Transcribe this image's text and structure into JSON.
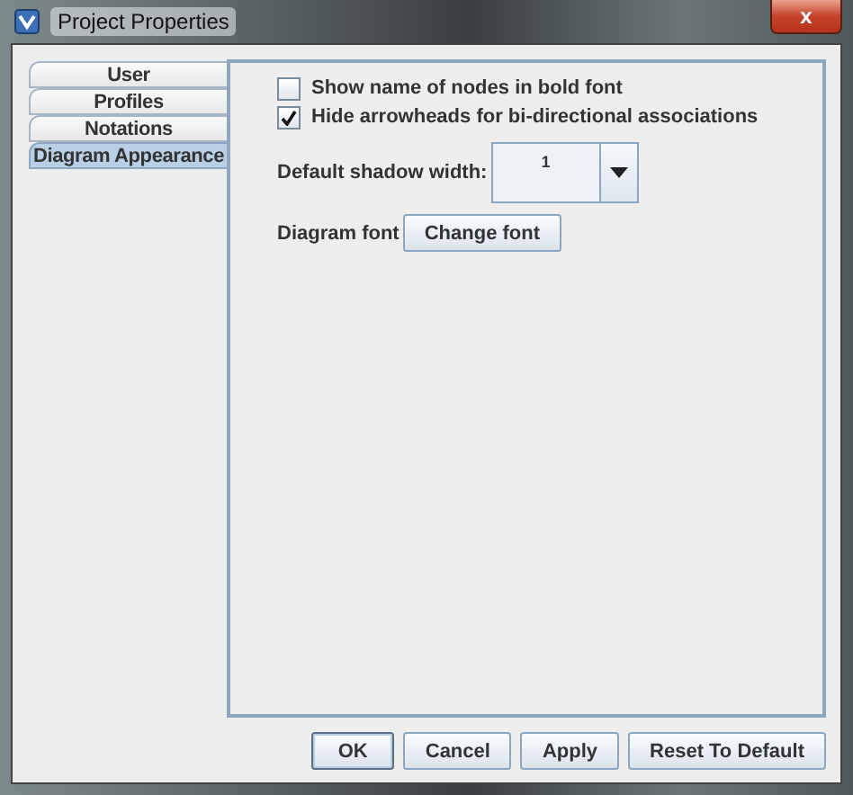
{
  "window": {
    "title": "Project Properties",
    "close": "x"
  },
  "tabs": [
    {
      "label": "User",
      "selected": false
    },
    {
      "label": "Profiles",
      "selected": false
    },
    {
      "label": "Notations",
      "selected": false
    },
    {
      "label": "Diagram Appearance",
      "selected": true
    }
  ],
  "options": [
    {
      "label": "Show name of nodes in bold font",
      "checked": false
    },
    {
      "label": "Hide arrowheads for bi-directional associations",
      "checked": true
    }
  ],
  "shadow_width": {
    "label": "Default shadow width:",
    "value": "1"
  },
  "diagram_font": {
    "label": "Diagram font",
    "button": "Change font"
  },
  "buttons": [
    "OK",
    "Cancel",
    "Apply",
    "Reset To Default"
  ]
}
